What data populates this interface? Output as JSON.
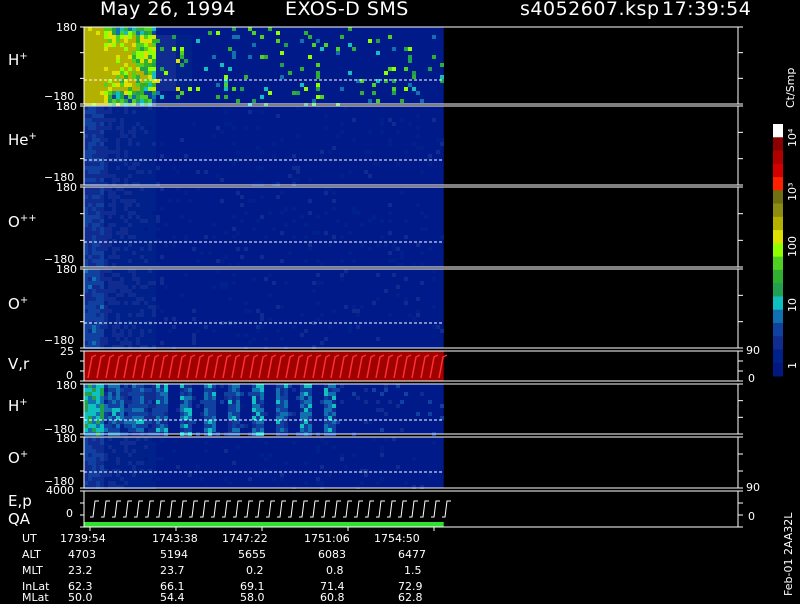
{
  "header": {
    "date": "May 26, 1994",
    "instrument": "EXOS-D SMS",
    "file": "s4052607.ksp",
    "time": "17:39:54"
  },
  "colorbar": {
    "unit": "Ct/Smp",
    "ticks": [
      "10⁴",
      "10³",
      "100",
      "10",
      "1"
    ],
    "colors": [
      "#ffffff",
      "#8b0000",
      "#b00000",
      "#d40000",
      "#ff2000",
      "#707010",
      "#8c8c10",
      "#b4b000",
      "#e0e000",
      "#90ff00",
      "#50d020",
      "#30b030",
      "#20a050",
      "#10c0c0",
      "#1070b0",
      "#1040a0",
      "#102c90",
      "#00208a",
      "#001880"
    ]
  },
  "panels": [
    {
      "label": "H",
      "sup": "+",
      "top_tick": "180",
      "bottom_tick": "−180"
    },
    {
      "label": "He",
      "sup": "+",
      "top_tick": "180",
      "bottom_tick": "−180"
    },
    {
      "label": "O",
      "sup": "++",
      "top_tick": "180",
      "bottom_tick": "−180"
    },
    {
      "label": "O",
      "sup": "+",
      "top_tick": "180",
      "bottom_tick": "−180"
    },
    {
      "label": "V,r",
      "sup": "",
      "top_tick": "25",
      "bottom_tick": "0",
      "right_top": "90",
      "right_bottom": "0"
    },
    {
      "label": "H",
      "sup": "+",
      "top_tick": "180",
      "bottom_tick": "−180"
    },
    {
      "label": "O",
      "sup": "+",
      "top_tick": "180",
      "bottom_tick": "−180"
    },
    {
      "label": "E,p",
      "label2": "QA",
      "sup": "",
      "top_tick": "4000",
      "bottom_tick": "0",
      "right_top": "90",
      "right_bottom": "0"
    }
  ],
  "side_note": "Feb-01 2AA32L",
  "ut_table": {
    "rows": [
      {
        "name": "UT",
        "values": [
          "1739:54",
          "1743:38",
          "1747:22",
          "1751:06",
          "1754:50"
        ]
      },
      {
        "name": "ALT",
        "values": [
          "4703",
          "5194",
          "5655",
          "6083",
          "6477"
        ]
      },
      {
        "name": "MLT",
        "values": [
          "23.2",
          "23.7",
          "0.2",
          "0.8",
          "1.5"
        ]
      },
      {
        "name": "InLat",
        "values": [
          "62.3",
          "66.1",
          "69.1",
          "71.4",
          "72.9"
        ]
      },
      {
        "name": "MLat",
        "values": [
          "50.0",
          "54.4",
          "58.0",
          "60.8",
          "62.8"
        ]
      }
    ]
  },
  "chart_data": {
    "type": "heatmap",
    "title": "May 26, 1994   EXOS-D SMS",
    "x": [
      "1739:54",
      "1743:38",
      "1747:22",
      "1751:06",
      "1754:50"
    ],
    "data_coverage_end_fraction": 0.55,
    "series": [
      {
        "name": "H+",
        "ylim": [
          -180,
          180
        ],
        "intensity": "high near start, decreasing"
      },
      {
        "name": "He+",
        "ylim": [
          -180,
          180
        ],
        "intensity": "low"
      },
      {
        "name": "O++",
        "ylim": [
          -180,
          180
        ],
        "intensity": "low"
      },
      {
        "name": "O+",
        "ylim": [
          -180,
          180
        ],
        "intensity": "low"
      },
      {
        "name": "V,r",
        "ylim": [
          0,
          25
        ],
        "right_ylim": [
          0,
          90
        ]
      },
      {
        "name": "H+",
        "ylim": [
          -180,
          180
        ],
        "intensity": "moderate, striped"
      },
      {
        "name": "O+",
        "ylim": [
          -180,
          180
        ],
        "intensity": "low"
      },
      {
        "name": "E,p QA",
        "ylim": [
          0,
          4000
        ],
        "right_ylim": [
          0,
          90
        ]
      }
    ],
    "color_scale": "log",
    "color_range": [
      1,
      10000
    ]
  }
}
